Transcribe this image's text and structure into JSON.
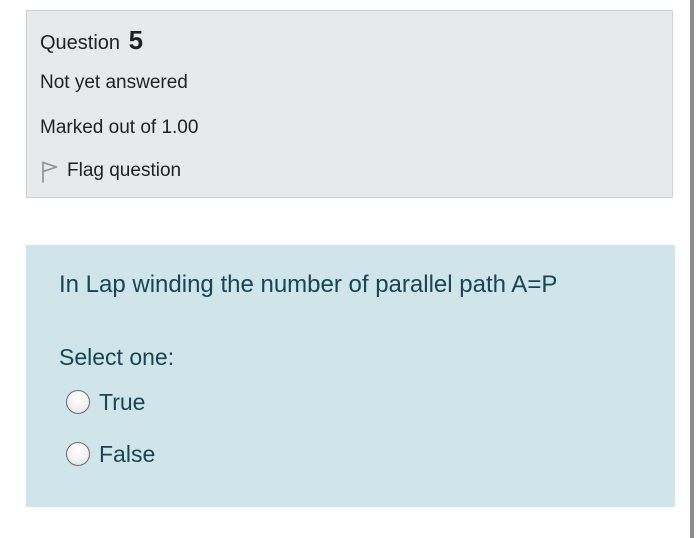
{
  "question_info": {
    "heading_label": "Question",
    "number": "5",
    "status": "Not yet answered",
    "marks": "Marked out of 1.00",
    "flag_label": "Flag question",
    "flag_icon": "flag-icon"
  },
  "formulation": {
    "question_text": "In Lap winding the number of parallel path A=P",
    "prompt": "Select one:",
    "options": [
      {
        "label": "True",
        "selected": false
      },
      {
        "label": "False",
        "selected": false
      }
    ]
  },
  "colors": {
    "info_background": "#e8e9ec",
    "formulation_background": "#cfe5ea",
    "formulation_text": "#164654"
  }
}
